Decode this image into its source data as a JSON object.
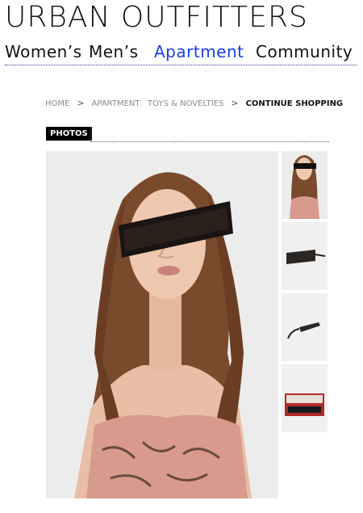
{
  "header": {
    "logo_text": "URBAN OUTFITTERS"
  },
  "nav": {
    "items": [
      {
        "label": "Women’s",
        "active": false
      },
      {
        "label": "Men’s",
        "active": false
      },
      {
        "label": "Apartment",
        "active": true
      },
      {
        "label": "Community",
        "active": false
      }
    ]
  },
  "breadcrumb": {
    "items": [
      "HOME",
      "APARTMENT",
      "TOYS & NOVELTIES"
    ],
    "separator": ">",
    "current": "CONTINUE SHOPPING"
  },
  "photos": {
    "tab_label": "PHOTOS",
    "main_photo_icon": "model-wearing-censor-bar-glasses",
    "thumbnails": [
      {
        "icon": "model-thumbnail",
        "selected": true
      },
      {
        "icon": "glasses-front-thumbnail",
        "selected": false
      },
      {
        "icon": "glasses-side-thumbnail",
        "selected": false
      },
      {
        "icon": "packaging-thumbnail",
        "selected": false
      }
    ]
  },
  "colors": {
    "nav_active": "#1a3ee6",
    "text": "#111111",
    "breadcrumb_muted": "#8a8a8a",
    "tab_bg": "#000000"
  }
}
